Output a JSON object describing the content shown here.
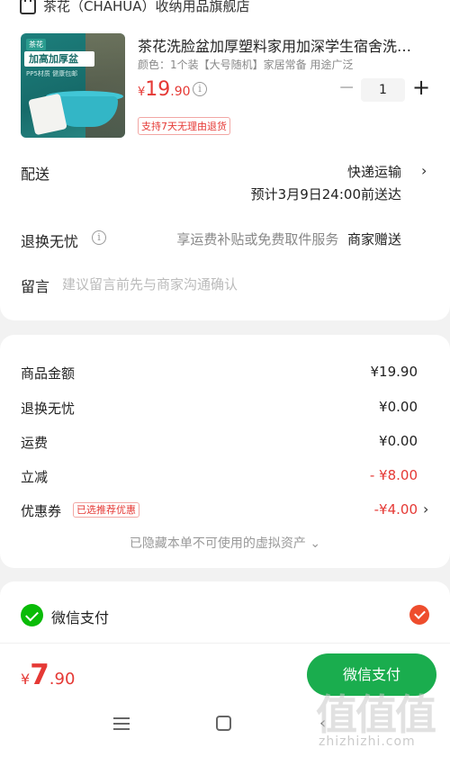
{
  "shop": {
    "name": "茶花（CHAHUA）收纳用品旗舰店"
  },
  "product": {
    "title": "茶花洗脸盆加厚塑料家用加深学生宿舍洗…",
    "spec": "颜色：1个装【大号随机】家居常备 用途广泛",
    "image": {
      "tag": "茶花",
      "banner": "加高加厚盆",
      "sub": "PP5材质 健康包邮"
    },
    "price": {
      "currency": "¥",
      "integer": "19",
      "decimal": ".90"
    },
    "quantity": "1",
    "policy": "支持7天无理由退货"
  },
  "delivery": {
    "label": "配送",
    "method": "快递运输",
    "eta": "预计3月9日24:00前送达"
  },
  "returns": {
    "label": "退换无忧",
    "desc": "享运费补贴或免费取件服务",
    "gift": "商家赠送"
  },
  "note": {
    "label": "留言",
    "placeholder": "建议留言前先与商家沟通确认"
  },
  "pricing": {
    "rows": [
      {
        "label": "商品金额",
        "value": "¥19.90"
      },
      {
        "label": "退换无忧",
        "value": "¥0.00"
      },
      {
        "label": "运费",
        "value": "¥0.00"
      },
      {
        "label": "立减",
        "value": "- ¥8.00"
      },
      {
        "label": "优惠券",
        "value": "-¥4.00"
      }
    ],
    "coupon_badge": "已选推荐优惠",
    "hidden_note": "已隐藏本单不可使用的虚拟资产 ⌄"
  },
  "payment": {
    "method": "微信支付",
    "total": {
      "currency": "¥",
      "integer": "7",
      "decimal": ".90"
    },
    "button": "微信支付"
  },
  "watermark": {
    "glyphs": "值值值",
    "domain": "zhizhizhi.com"
  },
  "colors": {
    "accent": "#e53935",
    "wechat_green": "#1aad4e",
    "check": "#ee4d2d"
  }
}
